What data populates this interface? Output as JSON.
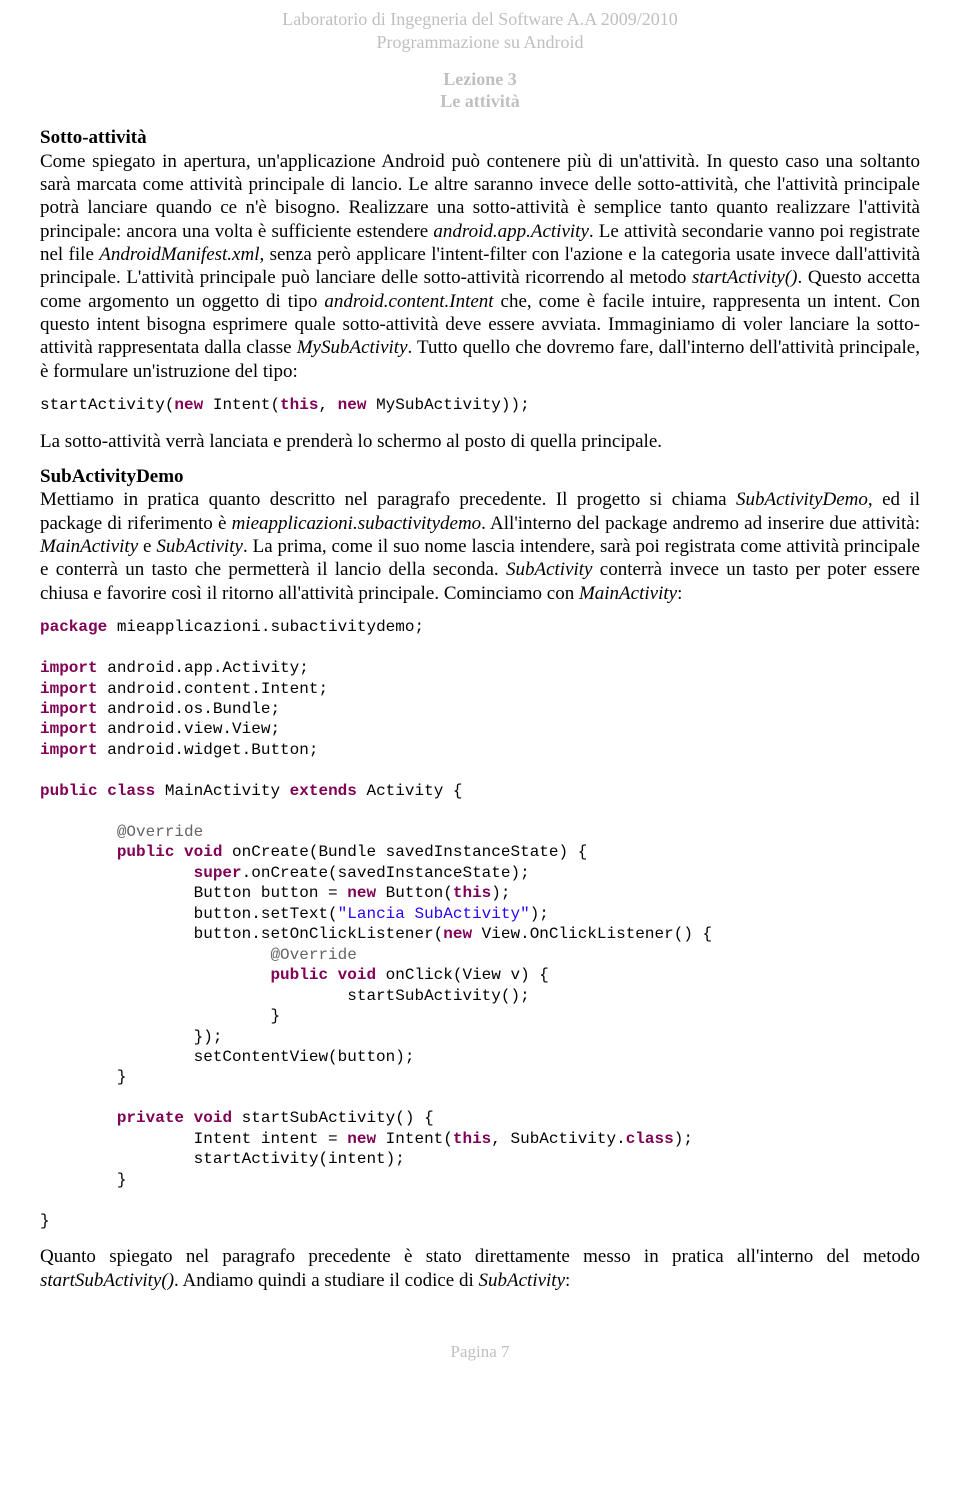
{
  "header": {
    "line1": "Laboratorio di Ingegneria del Software A.A 2009/2010",
    "line2": "Programmazione su Android",
    "lesson1": "Lezione 3",
    "lesson2": "Le attività"
  },
  "section1": {
    "title": "Sotto-attività",
    "p1a": "Come spiegato in apertura, un'applicazione Android può contenere più di un'attività. In questo caso una soltanto sarà marcata come attività principale di lancio. Le altre saranno invece delle sotto-attività, che l'attività principale potrà lanciare quando ce n'è bisogno. Realizzare una sotto-attività è semplice tanto quanto realizzare l'attività principale: ancora una volta è sufficiente estendere ",
    "p1i1": "android.app.Activity",
    "p1b": ". Le attività secondarie vanno poi registrate nel file ",
    "p1i2": "AndroidManifest.xml",
    "p1c": ", senza però applicare l'intent-filter con l'azione e la categoria usate invece dall'attività principale. L'attività principale può lanciare delle sotto-attività ricorrendo al metodo ",
    "p1i3": "startActivity()",
    "p1d": ". Questo accetta come argomento un oggetto di tipo ",
    "p1i4": "android.content.Intent",
    "p1e": " che, come è facile intuire, rappresenta un intent. Con questo intent bisogna esprimere quale sotto-attività deve essere avviata. Immaginiamo di voler lanciare la sotto-attività rappresentata dalla classe ",
    "p1i5": "MySubActivity",
    "p1f": ". Tutto quello che dovremo fare, dall'interno dell'attività principale, è formulare un'istruzione del tipo:"
  },
  "code1": {
    "t1": "startActivity(",
    "kw1": "new",
    "t2": " Intent(",
    "kw2": "this",
    "t3": ", ",
    "kw3": "new",
    "t4": " MySubActivity));"
  },
  "after_code1": "La sotto-attività verrà lanciata e prenderà lo schermo al posto di quella principale.",
  "section2": {
    "title": "SubActivityDemo",
    "p1a": "Mettiamo in pratica quanto descritto nel paragrafo precedente. Il progetto si chiama ",
    "p1i1": "SubActivityDemo",
    "p1b": ", ed il package di riferimento è ",
    "p1i2": "mieapplicazioni.subactivitydemo",
    "p1c": ". All'interno del package andremo ad inserire due attività: ",
    "p1i3": "MainActivity",
    "p1d": " e ",
    "p1i4": "SubActivity",
    "p1e": ". La prima, come il suo nome lascia intendere, sarà poi registrata come attività principale e conterrà un tasto che permetterà il lancio della seconda. ",
    "p1i5": "SubActivity",
    "p1f": " conterrà invece un tasto per poter essere chiusa e favorire così il ritorno all'attività principale. Cominciamo con ",
    "p1i6": "MainActivity",
    "p1g": ":"
  },
  "code2": {
    "kw_package": "package",
    "t_pkg": " mieapplicazioni.subactivitydemo;",
    "kw_import": "import",
    "imp1": " android.app.Activity;",
    "imp2": " android.content.Intent;",
    "imp3": " android.os.Bundle;",
    "imp4": " android.view.View;",
    "imp5": " android.widget.Button;",
    "kw_public": "public",
    "kw_class": "class",
    "t_classname": " MainActivity ",
    "kw_extends": "extends",
    "t_ext": " Activity {",
    "ann_override": "@Override",
    "kw_void": "void",
    "t_oncreate": " onCreate(Bundle savedInstanceState) {",
    "kw_super": "super",
    "t_superline": ".onCreate(savedInstanceState);",
    "t_btn1": "                Button button = ",
    "kw_new": "new",
    "t_btn2": " Button(",
    "kw_this": "this",
    "t_btn3": ");",
    "t_settext1": "                button.setText(",
    "str1": "\"Lancia SubActivity\"",
    "t_settext2": ");",
    "t_listener1": "                button.setOnClickListener(",
    "t_listener2": " View.OnClickListener() {",
    "t_onclick": " onClick(View v) {",
    "t_startcall": "                                startSubActivity();",
    "t_close1": "                        }",
    "t_close2": "                });",
    "t_setcontent": "                setContentView(button);",
    "t_close3": "        }",
    "kw_private": "private",
    "t_startsub": " startSubActivity() {",
    "t_intent1": "                Intent intent = ",
    "t_intent2": " Intent(",
    "t_intent3": ", SubActivity.",
    "kw_classlit": "class",
    "t_intent4": ");",
    "t_startact": "                startActivity(intent);",
    "t_close4": "        }",
    "t_close5": "}"
  },
  "section3": {
    "p1a": "Quanto spiegato nel paragrafo precedente è stato direttamente messo in pratica all'interno del metodo ",
    "p1i1": "startSubActivity()",
    "p1b": ". Andiamo quindi a studiare il codice di ",
    "p1i2": "SubActivity",
    "p1c": ":"
  },
  "footer": "Pagina 7"
}
